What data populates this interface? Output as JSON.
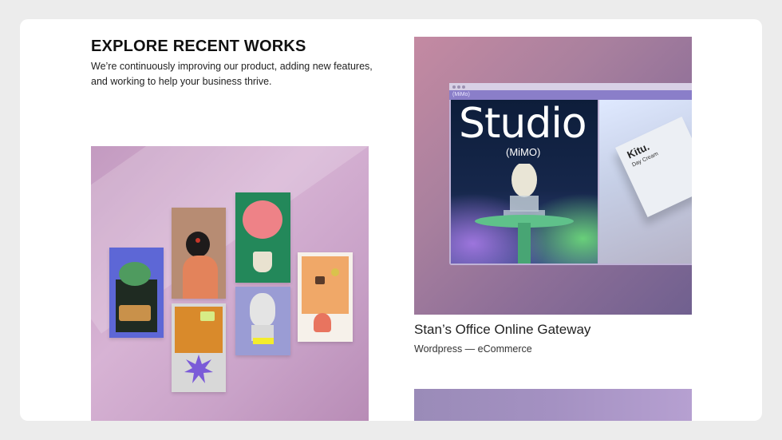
{
  "section": {
    "title": "EXPLORE RECENT WORKS",
    "description": "We’re continuously improving our product, adding new features, and working to help your business thrive."
  },
  "featured_project": {
    "mockup_brand": "Studio",
    "mockup_sub": "(MiMO)",
    "mockup_nav": "(MiMo)",
    "product_brand": "Kitu.",
    "product_sub": "Day Cream",
    "title": "Stan’s Office Online Gateway",
    "meta": "Wordpress — eCommerce"
  },
  "colors": {
    "page_bg": "#ececec",
    "card_bg": "#ffffff",
    "left_image": "#c9a2c8",
    "right_image": "#8e6f98"
  }
}
